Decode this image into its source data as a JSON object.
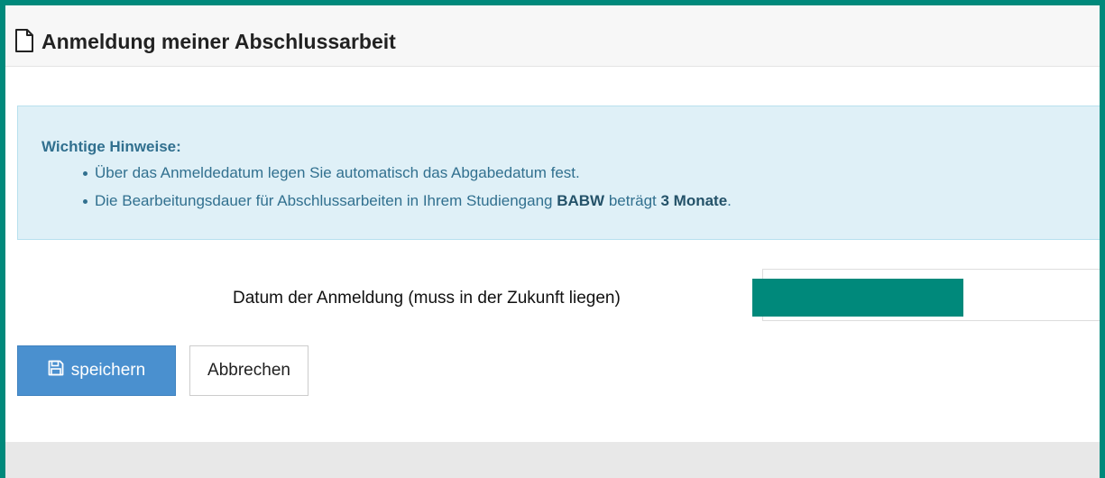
{
  "header": {
    "title": "Anmeldung meiner Abschlussarbeit",
    "icon": "file-icon"
  },
  "notice": {
    "heading": "Wichtige Hinweise:",
    "item1": "Über das Anmeldedatum legen Sie automatisch das Abgabedatum fest.",
    "item2_prefix": "Die Bearbeitungsdauer für Abschlussarbeiten in Ihrem Studiengang ",
    "item2_program": "BABW",
    "item2_middle": " beträgt ",
    "item2_duration": "3 Monate",
    "item2_suffix": "."
  },
  "form": {
    "date_label": "Datum der Anmeldung (muss in der Zukunft liegen)",
    "date_value": ""
  },
  "buttons": {
    "save_label": "speichern",
    "save_icon": "floppy-disk-icon",
    "cancel_label": "Abbrechen"
  },
  "colors": {
    "frame_border": "#00897b",
    "alert_background": "#dff0f7",
    "alert_text": "#31708f",
    "primary_button": "#4a90cf"
  }
}
